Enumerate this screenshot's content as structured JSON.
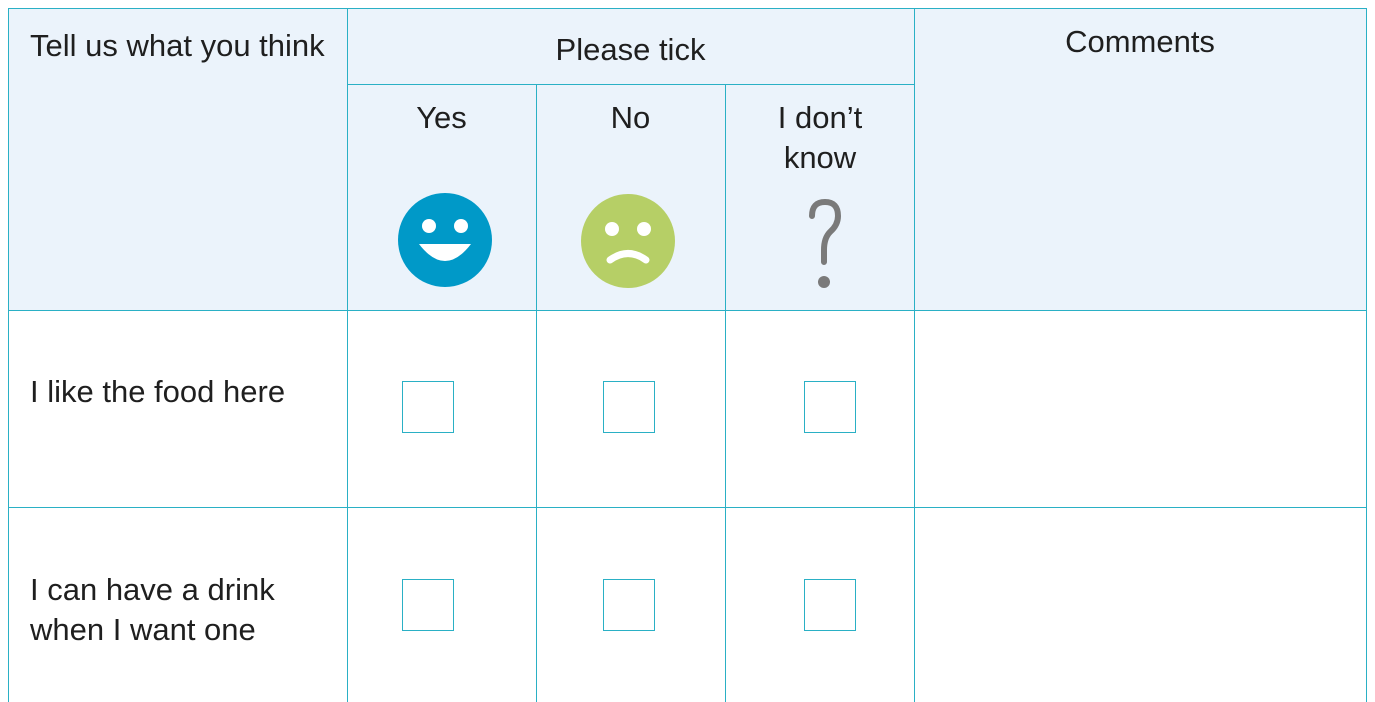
{
  "header": {
    "col1_label": "Tell us what you think",
    "tick_label": "Please tick",
    "comments_label": "Comments",
    "options": [
      {
        "label": "Yes",
        "icon": "happy-face-icon",
        "color": "#0099c8"
      },
      {
        "label": "No",
        "icon": "sad-face-icon",
        "color": "#b6cf66"
      },
      {
        "label": "I don’t know",
        "icon": "question-mark-icon",
        "color": "#7a7a7a"
      }
    ]
  },
  "rows": [
    {
      "statement": "I like the food here",
      "yes": false,
      "no": false,
      "dont_know": false,
      "comment": ""
    },
    {
      "statement": "I can have a drink when I want one",
      "yes": false,
      "no": false,
      "dont_know": false,
      "comment": ""
    }
  ],
  "colors": {
    "border": "#2ab0c5",
    "header_bg": "#ebf3fb"
  }
}
